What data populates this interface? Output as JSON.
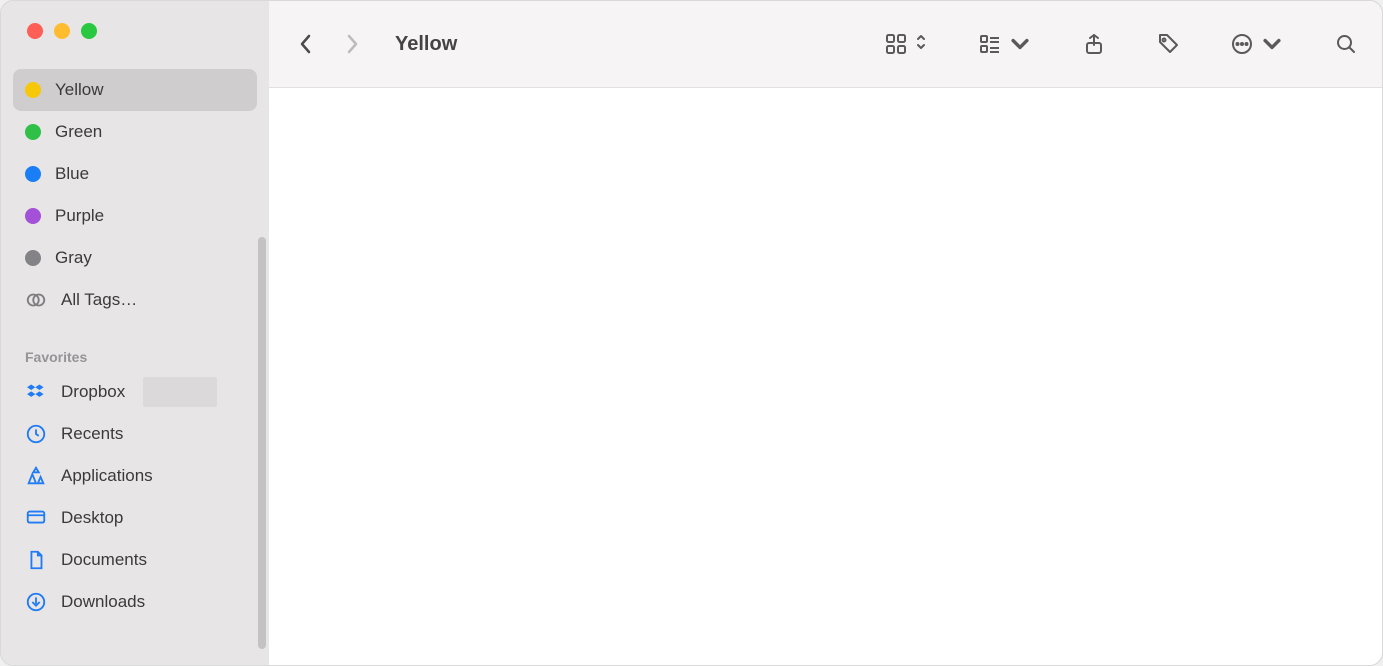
{
  "window": {
    "title": "Yellow"
  },
  "sidebar": {
    "tags": [
      {
        "label": "Yellow",
        "color": "#f7c70a",
        "selected": true
      },
      {
        "label": "Green",
        "color": "#30c048",
        "selected": false
      },
      {
        "label": "Blue",
        "color": "#1a7ff6",
        "selected": false
      },
      {
        "label": "Purple",
        "color": "#a450d8",
        "selected": false
      },
      {
        "label": "Gray",
        "color": "#838387",
        "selected": false
      }
    ],
    "all_tags_label": "All Tags…",
    "favorites_header": "Favorites",
    "favorites": [
      {
        "label": "Dropbox"
      },
      {
        "label": "Recents"
      },
      {
        "label": "Applications"
      },
      {
        "label": "Desktop"
      },
      {
        "label": "Documents"
      },
      {
        "label": "Downloads"
      }
    ]
  }
}
